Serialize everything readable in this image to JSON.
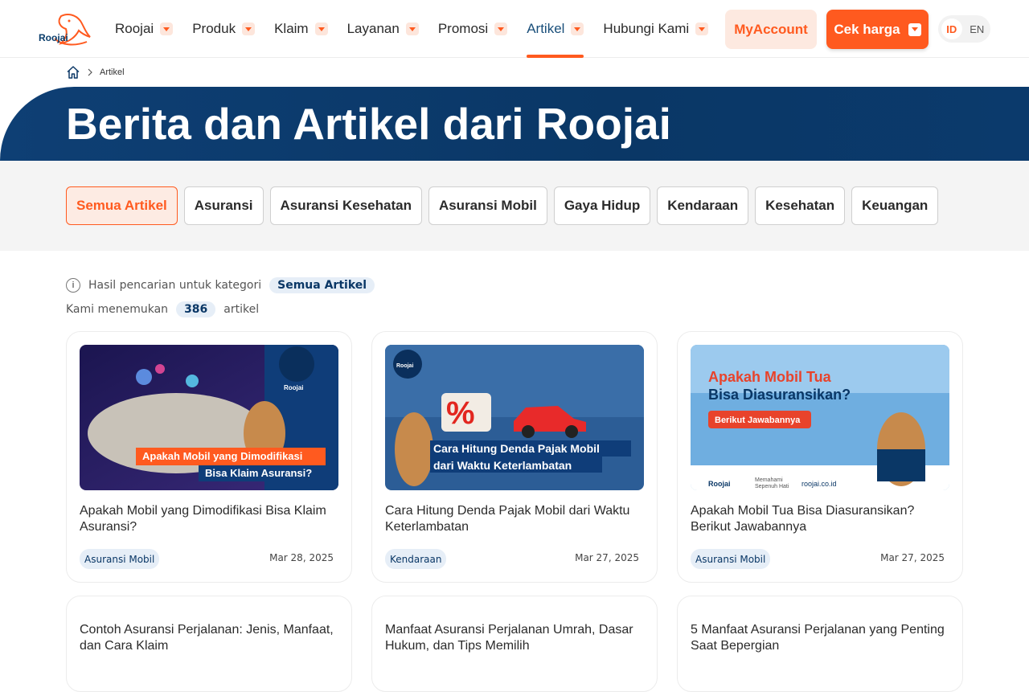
{
  "logo": {
    "text": "Roojai"
  },
  "nav": {
    "items": [
      {
        "label": "Roojai",
        "active": false
      },
      {
        "label": "Produk",
        "active": false
      },
      {
        "label": "Klaim",
        "active": false
      },
      {
        "label": "Layanan",
        "active": false
      },
      {
        "label": "Promosi",
        "active": false
      },
      {
        "label": "Artikel",
        "active": true
      },
      {
        "label": "Hubungi Kami",
        "active": false
      }
    ],
    "myaccount_label": "MyAccount",
    "cek_harga_label": "Cek harga",
    "lang": {
      "id": "ID",
      "en": "EN",
      "selected": "ID"
    }
  },
  "breadcrumb": {
    "current": "Artikel"
  },
  "hero": {
    "title": "Berita dan Artikel dari Roojai"
  },
  "filters": {
    "chips": [
      {
        "label": "Semua Artikel",
        "active": true
      },
      {
        "label": "Asuransi",
        "active": false
      },
      {
        "label": "Asuransi Kesehatan",
        "active": false
      },
      {
        "label": "Asuransi Mobil",
        "active": false
      },
      {
        "label": "Gaya Hidup",
        "active": false
      },
      {
        "label": "Kendaraan",
        "active": false
      },
      {
        "label": "Kesehatan",
        "active": false
      },
      {
        "label": "Keuangan",
        "active": false
      }
    ]
  },
  "results": {
    "prefix": "Hasil pencarian untuk kategori",
    "category": "Semua Artikel",
    "found_prefix": "Kami menemukan",
    "count": "386",
    "found_suffix": "artikel"
  },
  "articles": [
    {
      "title": "Apakah Mobil yang Dimodifikasi Bisa Klaim Asuransi?",
      "tag": "Asuransi Mobil",
      "date": "Mar 28, 2025",
      "thumb_caption_1": "Apakah Mobil yang Dimodifikasi",
      "thumb_caption_2": "Bisa Klaim Asuransi?"
    },
    {
      "title": "Cara Hitung Denda Pajak Mobil dari Waktu Keterlambatan",
      "tag": "Kendaraan",
      "date": "Mar 27, 2025",
      "thumb_caption_1": "Cara Hitung Denda Pajak Mobil",
      "thumb_caption_2": "dari Waktu Keterlambatan"
    },
    {
      "title": "Apakah Mobil Tua Bisa Diasuransikan? Berikut Jawabannya",
      "tag": "Asuransi Mobil",
      "date": "Mar 27, 2025",
      "thumb_caption_1": "Apakah Mobil Tua",
      "thumb_caption_2": "Bisa Diasuransikan?",
      "thumb_caption_3": "Berikut Jawabannya",
      "thumb_footer_1": "Memahami",
      "thumb_footer_2": "Sepenuh Hati",
      "thumb_site": "roojai.co.id"
    },
    {
      "title": "Contoh Asuransi Perjalanan: Jenis, Manfaat, dan Cara Klaim"
    },
    {
      "title": "Manfaat Asuransi Perjalanan Umrah, Dasar Hukum, dan Tips Memilih"
    },
    {
      "title": "5 Manfaat Asuransi Perjalanan yang Penting Saat Bepergian"
    }
  ],
  "colors": {
    "brand_orange": "#ff5a1f",
    "brand_navy": "#0a3766"
  }
}
